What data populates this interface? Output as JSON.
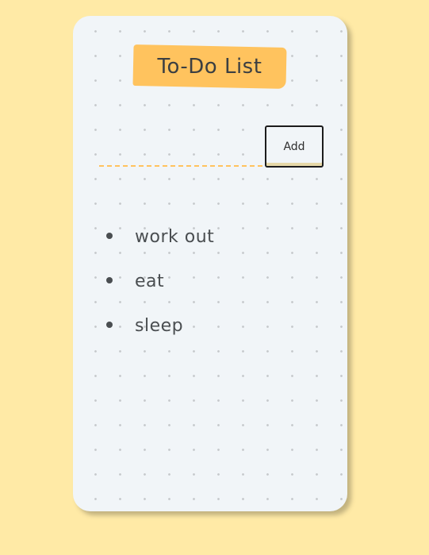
{
  "app": {
    "title": "To-Do List"
  },
  "form": {
    "input_value": "",
    "add_label": "Add"
  },
  "tasks": [
    {
      "text": "work out"
    },
    {
      "text": "eat"
    },
    {
      "text": "sleep"
    }
  ],
  "colors": {
    "background": "#ffeaa6",
    "card": "#f1f5f8",
    "accent": "#ffc35e",
    "text": "#3b3f42"
  }
}
